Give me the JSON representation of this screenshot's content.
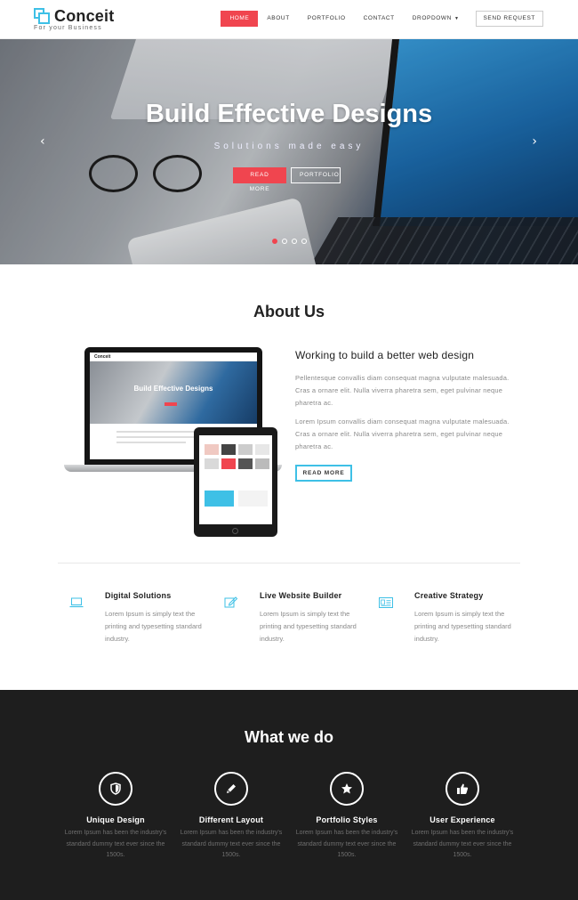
{
  "brand": {
    "name": "Conceit",
    "tagline": "For your Business"
  },
  "nav": {
    "items": [
      {
        "label": "HOME",
        "active": true
      },
      {
        "label": "ABOUT"
      },
      {
        "label": "PORTFOLIO"
      },
      {
        "label": "CONTACT"
      },
      {
        "label": "DROPDOWN"
      }
    ],
    "cta": "SEND REQUEST"
  },
  "hero": {
    "title": "Build Effective Designs",
    "subtitle": "Solutions made easy",
    "primary_btn": "READ MORE",
    "secondary_btn": "PORTFOLIO",
    "slides": 4,
    "active_slide": 1
  },
  "about": {
    "title": "About Us",
    "heading": "Working to build a better web design",
    "p1": "Pellentesque convallis diam consequat magna vulputate malesuada. Cras a ornare elit. Nulla viverra pharetra sem, eget pulvinar neque pharetra ac.",
    "p2": "Lorem Ipsum convallis diam consequat magna vulputate malesuada. Cras a ornare elit. Nulla viverra pharetra sem, eget pulvinar neque pharetra ac.",
    "btn": "READ MORE",
    "mockup": {
      "logo": "Conceit",
      "hero_title": "Build Effective Designs"
    }
  },
  "features": [
    {
      "title": "Digital Solutions",
      "text": "Lorem Ipsum is simply text the printing and typesetting standard industry.",
      "icon": "laptop-icon"
    },
    {
      "title": "Live Website Builder",
      "text": "Lorem Ipsum is simply text the printing and typesetting standard industry.",
      "icon": "edit-icon"
    },
    {
      "title": "Creative Strategy",
      "text": "Lorem Ipsum is simply text the printing and typesetting standard industry.",
      "icon": "newspaper-icon"
    }
  ],
  "what_we_do": {
    "title": "What we do",
    "services": [
      {
        "title": "Unique Design",
        "text": "Lorem Ipsum has been the industry's standard dummy text ever since the 1500s.",
        "icon": "shield-icon"
      },
      {
        "title": "Different Layout",
        "text": "Lorem Ipsum has been the industry's standard dummy text ever since the 1500s.",
        "icon": "pencil-icon"
      },
      {
        "title": "Portfolio Styles",
        "text": "Lorem Ipsum has been the industry's standard dummy text ever since the 1500s.",
        "icon": "star-icon"
      },
      {
        "title": "User Experience",
        "text": "Lorem Ipsum has been the industry's standard dummy text ever since the 1500s.",
        "icon": "thumbs-up-icon"
      }
    ]
  },
  "colors": {
    "accent": "#f0454f",
    "brand_blue": "#3ec0e6",
    "dark": "#1e1e1e"
  }
}
